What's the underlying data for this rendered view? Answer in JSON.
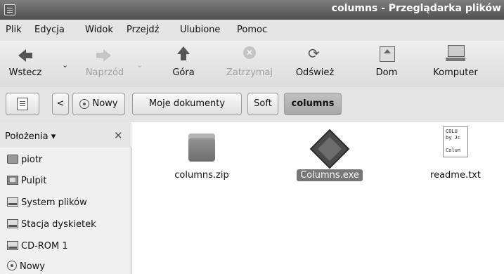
{
  "window": {
    "title": "columns - Przeglądarka plików"
  },
  "menu": [
    "Plik",
    "Edycja",
    "Widok",
    "Przejdź",
    "Ulubione",
    "Pomoc"
  ],
  "toolbar": {
    "back": "Wstecz",
    "forward": "Naprzód",
    "up": "Góra",
    "stop": "Zatrzymaj",
    "refresh": "Odśwież",
    "home": "Dom",
    "computer": "Komputer"
  },
  "pathbar": {
    "back_glyph": "<",
    "new_label": "Nowy",
    "crumbs": [
      "Moje dokumenty",
      "Soft",
      "columns"
    ]
  },
  "sidebar": {
    "title": "Położenia",
    "items": [
      {
        "label": "piotr",
        "icon": "home-folder-icon"
      },
      {
        "label": "Pulpit",
        "icon": "desktop-icon"
      },
      {
        "label": "System plików",
        "icon": "drive-icon"
      },
      {
        "label": "Stacja dyskietek",
        "icon": "floppy-icon"
      },
      {
        "label": "CD-ROM 1",
        "icon": "cdrom-icon"
      },
      {
        "label": "Nowy",
        "icon": "disc-icon"
      }
    ]
  },
  "files": [
    {
      "name": "columns.zip",
      "icon": "archive-icon",
      "selected": false
    },
    {
      "name": "Columns.exe",
      "icon": "exe-icon",
      "selected": true
    },
    {
      "name": "readme.txt",
      "icon": "text-file-icon",
      "selected": false,
      "preview": "COLU\nby Jc\n\nColun"
    }
  ]
}
